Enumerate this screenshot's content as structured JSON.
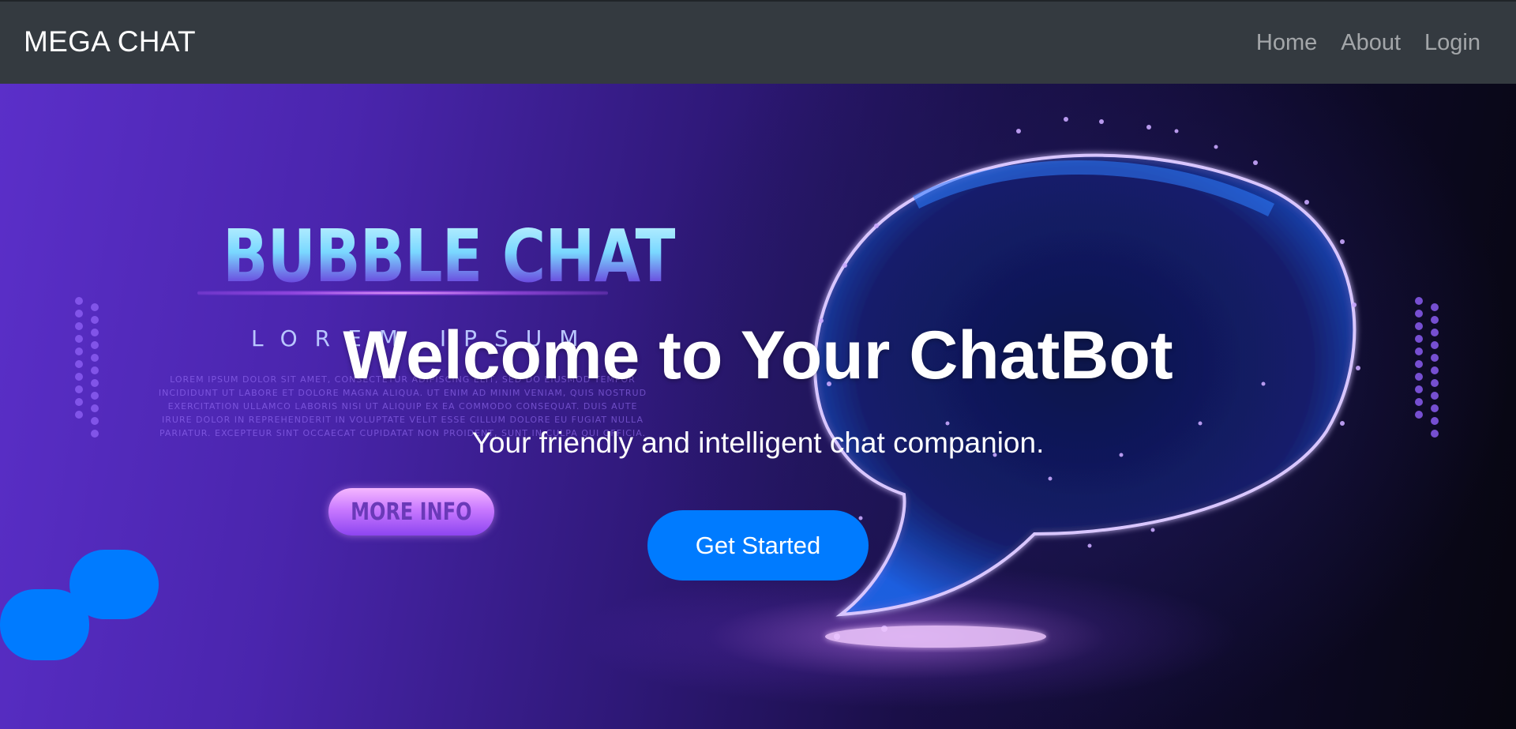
{
  "navbar": {
    "brand": "MEGA CHAT",
    "links": [
      {
        "label": "Home"
      },
      {
        "label": "About"
      },
      {
        "label": "Login"
      }
    ]
  },
  "hero": {
    "title": "Welcome to Your ChatBot",
    "subtitle": "Your friendly and intelligent chat companion.",
    "cta_label": "Get Started",
    "background_art": {
      "heading": "BUBBLE CHAT",
      "subheading": "LOREM IPSUM",
      "blurb": "LOREM IPSUM DOLOR SIT AMET, CONSECTETUR ADIPISCING ELIT, SED DO EIUSMOD TEMPOR INCIDIDUNT UT LABORE ET DOLORE MAGNA ALIQUA. UT ENIM AD MINIM VENIAM, QUIS NOSTRUD EXERCITATION ULLAMCO LABORIS NISI UT ALIQUIP EX EA COMMODO CONSEQUAT. DUIS AUTE IRURE DOLOR IN REPREHENDERIT IN VOLUPTATE VELIT ESSE CILLUM DOLORE EU FUGIAT NULLA PARIATUR. EXCEPTEUR SINT OCCAECAT CUPIDATAT NON PROIDENT, SUNT IN CULPA QUI OFFICIA.",
      "button_label": "MORE INFO"
    }
  },
  "colors": {
    "navbar_bg": "#343a40",
    "primary": "#007bff",
    "hero_purple": "#5b2fc9"
  },
  "icons": {
    "chat_widget": "chat-bubbles-icon"
  }
}
